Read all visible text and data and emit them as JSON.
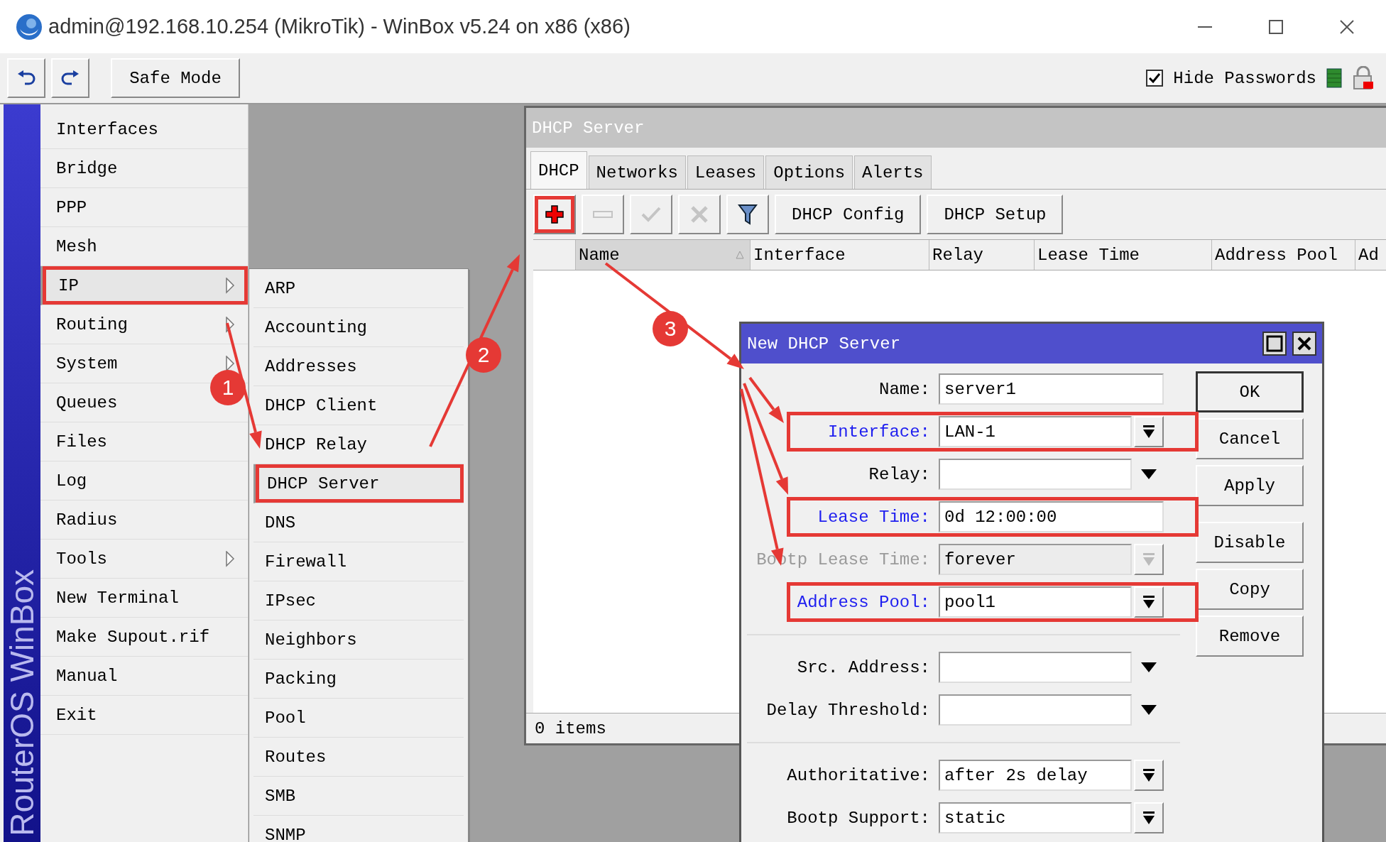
{
  "window": {
    "title": "admin@192.168.10.254 (MikroTik) - WinBox v5.24 on x86 (x86)"
  },
  "toolbar": {
    "safe_mode": "Safe Mode",
    "hide_passwords": {
      "label": "Hide Passwords",
      "checked": true
    }
  },
  "sidebar": {
    "brand": "RouterOS WinBox",
    "items": [
      {
        "label": "Interfaces",
        "submenu": false,
        "open": false,
        "boxed": false
      },
      {
        "label": "Bridge",
        "submenu": false,
        "open": false,
        "boxed": false
      },
      {
        "label": "PPP",
        "submenu": false,
        "open": false,
        "boxed": false
      },
      {
        "label": "Mesh",
        "submenu": false,
        "open": false,
        "boxed": false
      },
      {
        "label": "IP",
        "submenu": true,
        "open": true,
        "boxed": true
      },
      {
        "label": "Routing",
        "submenu": true,
        "open": false,
        "boxed": false
      },
      {
        "label": "System",
        "submenu": true,
        "open": false,
        "boxed": false
      },
      {
        "label": "Queues",
        "submenu": false,
        "open": false,
        "boxed": false
      },
      {
        "label": "Files",
        "submenu": false,
        "open": false,
        "boxed": false
      },
      {
        "label": "Log",
        "submenu": false,
        "open": false,
        "boxed": false
      },
      {
        "label": "Radius",
        "submenu": false,
        "open": false,
        "boxed": false
      },
      {
        "label": "Tools",
        "submenu": true,
        "open": false,
        "boxed": false
      },
      {
        "label": "New Terminal",
        "submenu": false,
        "open": false,
        "boxed": false
      },
      {
        "label": "Make Supout.rif",
        "submenu": false,
        "open": false,
        "boxed": false
      },
      {
        "label": "Manual",
        "submenu": false,
        "open": false,
        "boxed": false
      },
      {
        "label": "Exit",
        "submenu": false,
        "open": false,
        "boxed": false
      }
    ]
  },
  "submenu": {
    "items": [
      {
        "label": "ARP",
        "selected": false,
        "boxed": false
      },
      {
        "label": "Accounting",
        "selected": false,
        "boxed": false
      },
      {
        "label": "Addresses",
        "selected": false,
        "boxed": false
      },
      {
        "label": "DHCP Client",
        "selected": false,
        "boxed": false
      },
      {
        "label": "DHCP Relay",
        "selected": false,
        "boxed": false
      },
      {
        "label": "DHCP Server",
        "selected": true,
        "boxed": true
      },
      {
        "label": "DNS",
        "selected": false,
        "boxed": false
      },
      {
        "label": "Firewall",
        "selected": false,
        "boxed": false
      },
      {
        "label": "IPsec",
        "selected": false,
        "boxed": false
      },
      {
        "label": "Neighbors",
        "selected": false,
        "boxed": false
      },
      {
        "label": "Packing",
        "selected": false,
        "boxed": false
      },
      {
        "label": "Pool",
        "selected": false,
        "boxed": false
      },
      {
        "label": "Routes",
        "selected": false,
        "boxed": false
      },
      {
        "label": "SMB",
        "selected": false,
        "boxed": false
      },
      {
        "label": "SNMP",
        "selected": false,
        "boxed": false
      }
    ]
  },
  "dhcp_window": {
    "title": "DHCP Server",
    "tabs": [
      {
        "label": "DHCP",
        "selected": true
      },
      {
        "label": "Networks",
        "selected": false
      },
      {
        "label": "Leases",
        "selected": false
      },
      {
        "label": "Options",
        "selected": false
      },
      {
        "label": "Alerts",
        "selected": false
      }
    ],
    "tools": [
      {
        "kind": "add",
        "disabled": false,
        "boxed": true
      },
      {
        "kind": "remove",
        "disabled": true,
        "boxed": false
      },
      {
        "kind": "enable",
        "disabled": true,
        "boxed": false
      },
      {
        "kind": "disable",
        "disabled": true,
        "boxed": false
      },
      {
        "kind": "filter",
        "disabled": false,
        "boxed": false
      }
    ],
    "buttons": [
      "DHCP Config",
      "DHCP Setup"
    ],
    "columns": [
      {
        "label": "Name",
        "sorted": true
      },
      {
        "label": "Interface",
        "sorted": false
      },
      {
        "label": "Relay",
        "sorted": false
      },
      {
        "label": "Lease Time",
        "sorted": false
      },
      {
        "label": "Address Pool",
        "sorted": false
      },
      {
        "label": "Ad",
        "sorted": false
      }
    ],
    "status": "0 items"
  },
  "dialog": {
    "title": "New DHCP Server",
    "fields": [
      {
        "kind": "text",
        "label": "Name:",
        "value": "server1",
        "emphasized": false,
        "disabled": false,
        "boxed": false
      },
      {
        "kind": "select",
        "label": "Interface:",
        "value": "LAN-1",
        "emphasized": true,
        "disabled": false,
        "boxed": true
      },
      {
        "kind": "optional",
        "label": "Relay:",
        "emphasized": false,
        "disabled": false,
        "boxed": false
      },
      {
        "kind": "text",
        "label": "Lease Time:",
        "value": "0d 12:00:00",
        "emphasized": true,
        "disabled": false,
        "boxed": true
      },
      {
        "kind": "select",
        "label": "Bootp Lease Time:",
        "value": "forever",
        "emphasized": false,
        "disabled": true,
        "boxed": false
      },
      {
        "kind": "select",
        "label": "Address Pool:",
        "value": "pool1",
        "emphasized": true,
        "disabled": false,
        "boxed": true
      },
      {
        "kind": "separator"
      },
      {
        "kind": "optional",
        "label": "Src. Address:",
        "emphasized": false,
        "disabled": false,
        "boxed": false
      },
      {
        "kind": "optional",
        "label": "Delay Threshold:",
        "emphasized": false,
        "disabled": false,
        "boxed": false
      },
      {
        "kind": "separator"
      },
      {
        "kind": "select",
        "label": "Authoritative:",
        "value": "after 2s delay",
        "emphasized": false,
        "disabled": false,
        "boxed": false
      },
      {
        "kind": "select",
        "label": "Bootp Support:",
        "value": "static",
        "emphasized": false,
        "disabled": false,
        "boxed": false
      }
    ],
    "buttons": [
      {
        "label": "OK",
        "default": true
      },
      {
        "label": "Cancel",
        "default": false
      },
      {
        "label": "Apply",
        "default": false
      },
      {
        "label": "Disable",
        "default": false
      },
      {
        "label": "Copy",
        "default": false
      },
      {
        "label": "Remove",
        "default": false
      }
    ]
  },
  "annotations": [
    {
      "label": "1"
    },
    {
      "label": "2"
    },
    {
      "label": "3"
    }
  ]
}
